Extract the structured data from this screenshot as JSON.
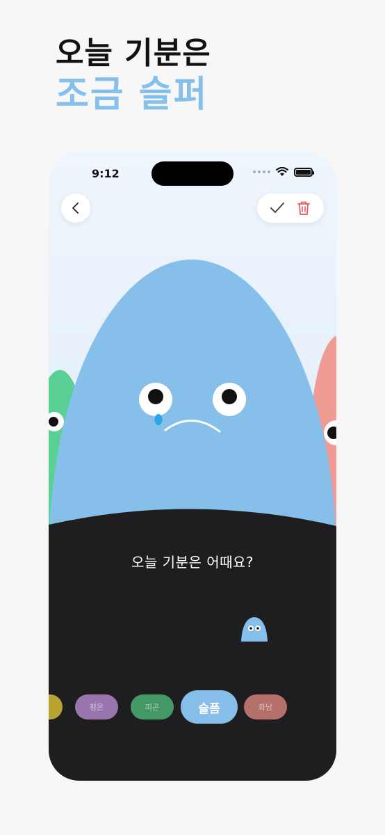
{
  "headline": {
    "line1": "오늘 기분은",
    "line2": "조금 슬퍼",
    "line2_color": "#86c0ea"
  },
  "status_bar": {
    "time": "9:12"
  },
  "nav": {
    "back_icon": "chevron-left-icon",
    "confirm_icon": "checkmark-icon",
    "delete_icon": "trash-icon"
  },
  "character": {
    "mood": "sad",
    "color": "#86c0ea",
    "tear_color": "#2aa6e8"
  },
  "side_characters": [
    {
      "side": "left",
      "color": "#5bd095"
    },
    {
      "side": "right",
      "color": "#ef9c94"
    }
  ],
  "prompt": {
    "question": "오늘 기분은 어때요?"
  },
  "moods": [
    {
      "label": "",
      "color": "#b9a22e",
      "active": false
    },
    {
      "label": "평온",
      "color": "#9976ae",
      "active": false
    },
    {
      "label": "피곤",
      "color": "#449866",
      "active": false
    },
    {
      "label": "슬픔",
      "color": "#86c0ea",
      "active": true
    },
    {
      "label": "화남",
      "color": "#b5706a",
      "active": false
    }
  ],
  "colors": {
    "dark_panel": "#1e1e20",
    "background": "#f7f7f8",
    "delete_red": "#e05a5a"
  }
}
